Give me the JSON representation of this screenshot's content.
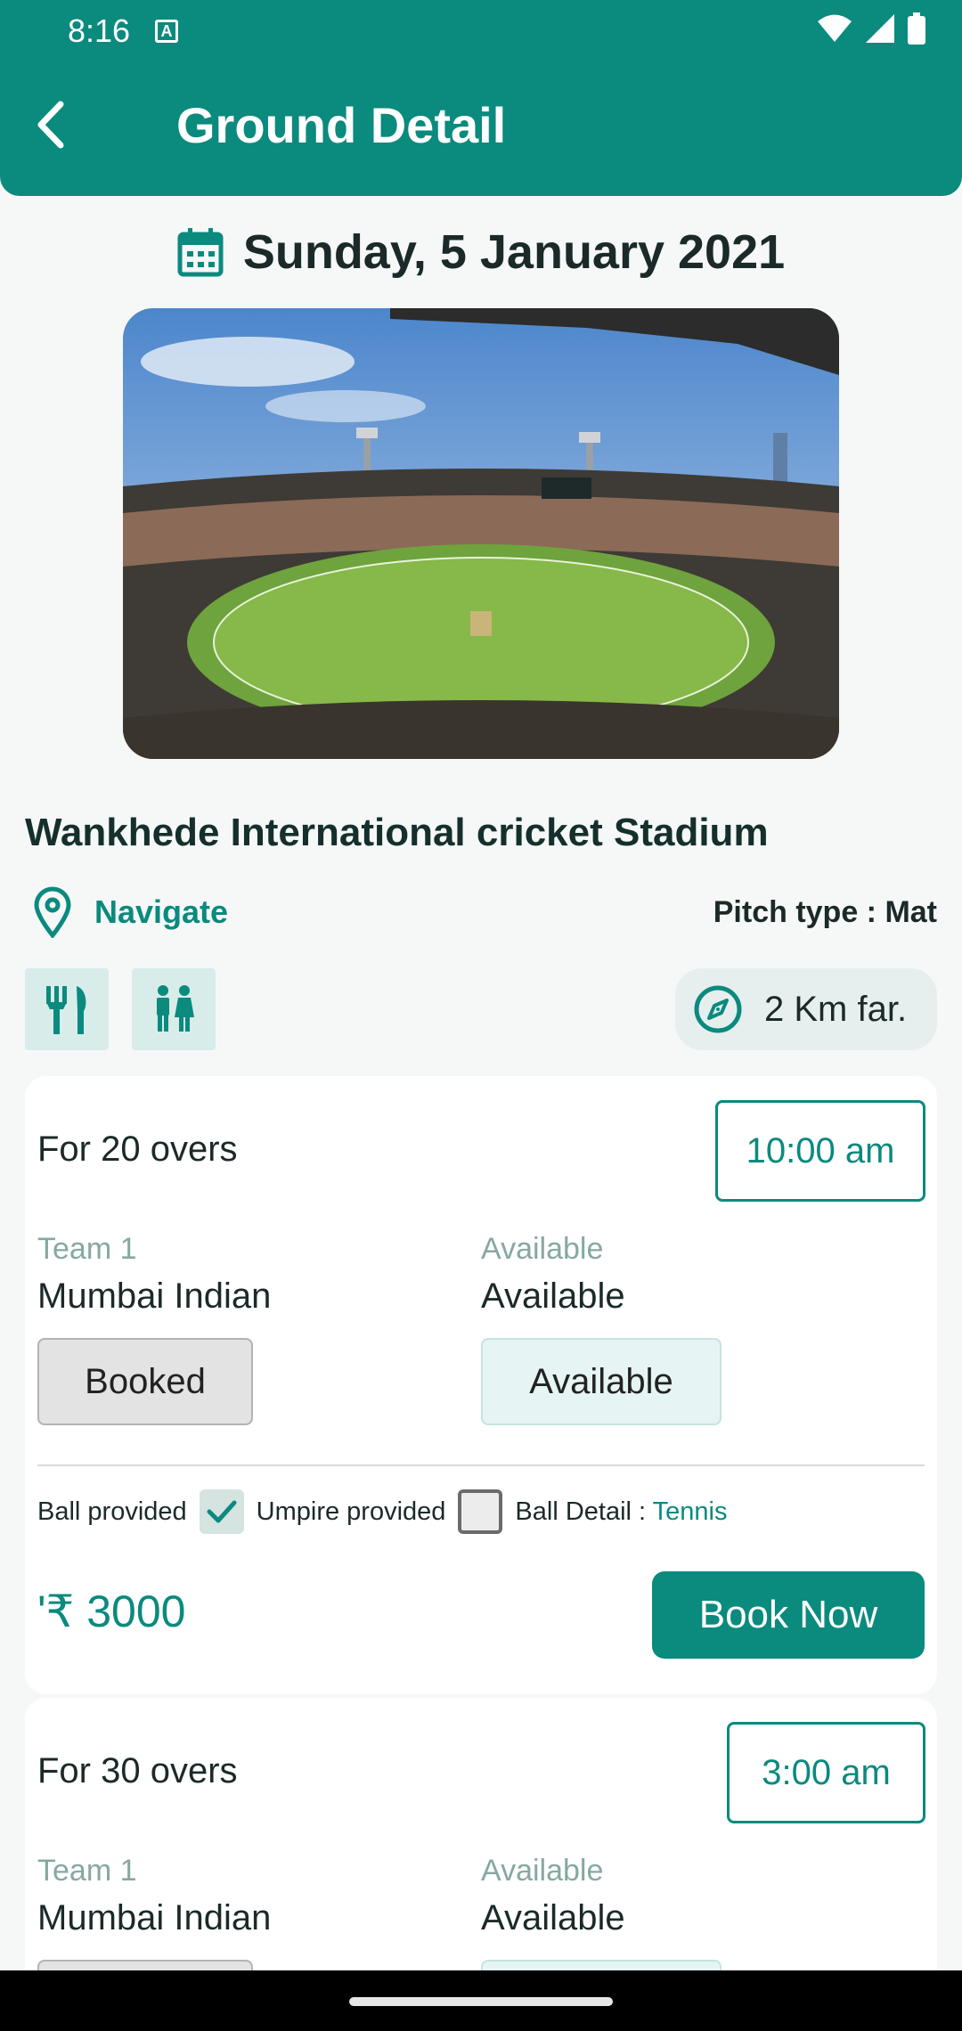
{
  "status_bar": {
    "time": "8:16",
    "notification_letter": "A"
  },
  "app_bar": {
    "title": "Ground Detail"
  },
  "date": "Sunday, 5 January 2021",
  "ground": {
    "name": "Wankhede International cricket Stadium",
    "navigate_label": "Navigate",
    "pitch_type": "Pitch type : Mat",
    "distance": "2 Km far."
  },
  "slots": [
    {
      "overs": "For 20 overs",
      "time": "10:00 am",
      "team_label": "Team 1",
      "team_value": "Mumbai Indian",
      "avail_label": "Available",
      "avail_value": "Available",
      "team_status_button": "Booked",
      "avail_status_button": "Available",
      "ball_provided_label": "Ball provided",
      "ball_provided_checked": true,
      "umpire_provided_label": "Umpire provided",
      "umpire_provided_checked": false,
      "ball_detail_label": "Ball Detail : ",
      "ball_detail_value": "Tennis",
      "price": "'₹ 3000",
      "book_label": "Book Now"
    },
    {
      "overs": "For 30 overs",
      "time": "3:00 am",
      "team_label": "Team 1",
      "team_value": "Mumbai Indian",
      "avail_label": "Available",
      "avail_value": "Available"
    }
  ],
  "colors": {
    "primary": "#0b8a7e",
    "background": "#f6f8f8",
    "card": "#ffffff"
  },
  "icons": {
    "back": "arrow-left-icon",
    "calendar": "calendar-icon",
    "location": "location-pin-icon",
    "restaurant": "fork-knife-icon",
    "restroom": "restroom-icon",
    "compass": "compass-icon"
  }
}
